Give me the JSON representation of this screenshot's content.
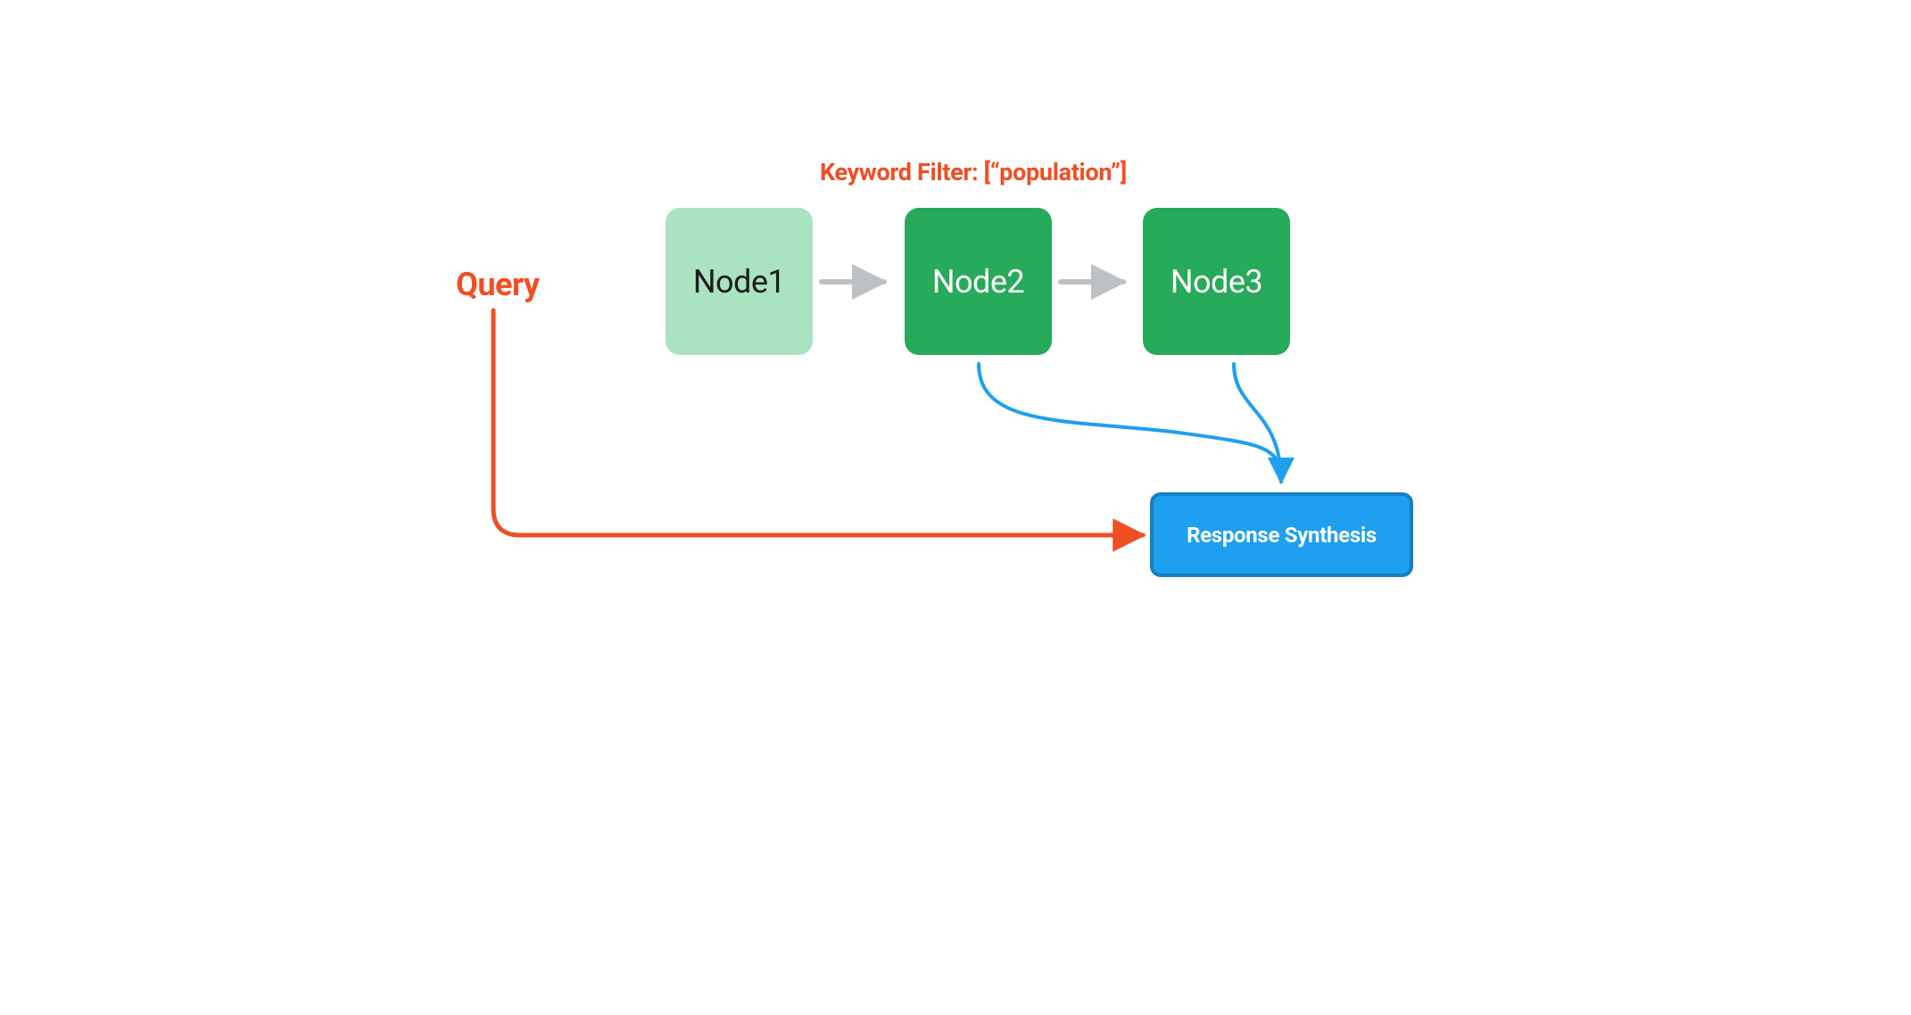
{
  "labels": {
    "query": "Query",
    "filter": "Keyword Filter: [“population”]"
  },
  "nodes": {
    "n1": "Node1",
    "n2": "Node2",
    "n3": "Node3"
  },
  "synthesis": "Response Synthesis",
  "colors": {
    "accent_red": "#F04E23",
    "node_filtered_bg": "#A9E3BF",
    "node_active_bg": "#27AA59",
    "arrow_gray": "#BEC1C4",
    "arrow_blue": "#1E9FF0",
    "synth_bg": "#1E9FF0",
    "synth_border": "#1580C3"
  },
  "diagram": {
    "description": "A query passes through a keyword filter. Node1 is filtered out; Node2 and Node3 pass and feed into Response Synthesis along with the original query.",
    "flow": [
      {
        "from": "Query",
        "to": "Response Synthesis",
        "color": "red"
      },
      {
        "from": "Node1",
        "to": "Node2",
        "color": "gray"
      },
      {
        "from": "Node2",
        "to": "Node3",
        "color": "gray"
      },
      {
        "from": "Node2",
        "to": "Response Synthesis",
        "color": "blue"
      },
      {
        "from": "Node3",
        "to": "Response Synthesis",
        "color": "blue"
      }
    ]
  }
}
